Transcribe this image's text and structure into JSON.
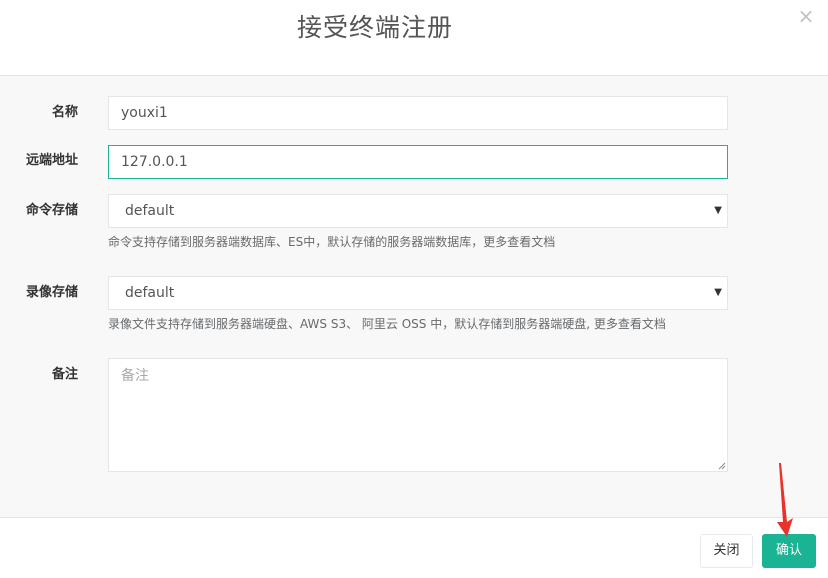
{
  "dialog": {
    "title": "接受终端注册",
    "close_glyph": "×"
  },
  "form": {
    "name": {
      "label": "名称",
      "value": "youxi1"
    },
    "remote_address": {
      "label": "远端地址",
      "value": "127.0.0.1"
    },
    "command_storage": {
      "label": "命令存储",
      "selected": "default",
      "help": "命令支持存储到服务器端数据库、ES中，默认存储的服务器端数据库，更多查看文档"
    },
    "replay_storage": {
      "label": "录像存储",
      "selected": "default",
      "help": "录像文件支持存储到服务器端硬盘、AWS S3、 阿里云 OSS 中，默认存储到服务器端硬盘, 更多查看文档"
    },
    "comment": {
      "label": "备注",
      "placeholder": "备注"
    }
  },
  "footer": {
    "close_label": "关闭",
    "confirm_label": "确认"
  },
  "colors": {
    "accent": "#1ab394",
    "annotation_arrow": "#e8322b"
  },
  "icons": {
    "close": "close-icon",
    "dropdown": "chevron-down-icon",
    "annotation": "red-arrow-icon"
  }
}
